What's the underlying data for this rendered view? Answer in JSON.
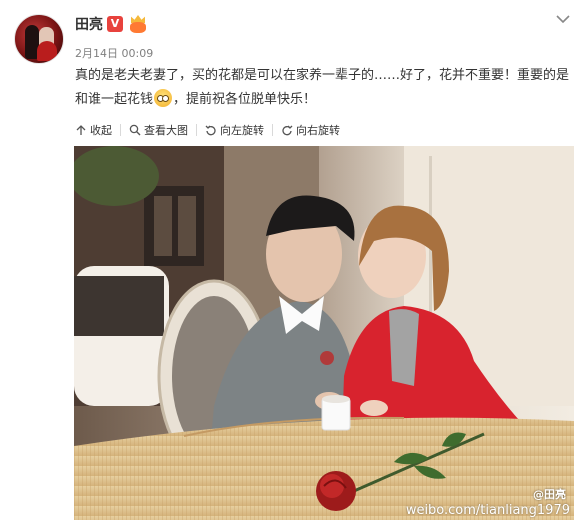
{
  "author": {
    "name": "田亮",
    "verified_badge": "V"
  },
  "post": {
    "time": "2月14日 00:09",
    "text_part1": "真的是老夫老妻了，买的花都是可以在家养一辈子的……好了，花并不重要！重要的是和谁一起花钱",
    "text_part2": "，提前祝各位脱单快乐！",
    "emoji_icon": "emoji-face-icon"
  },
  "toolbar": {
    "collapse": "收起",
    "view_large": "查看大图",
    "rotate_left": "向左旋转",
    "rotate_right": "向右旋转"
  },
  "photo": {
    "watermark_name": "@田亮",
    "watermark_url": "weibo.com/tianliang1979"
  },
  "colors": {
    "accent": "#e8423d",
    "text": "#333333",
    "muted": "#808080"
  }
}
